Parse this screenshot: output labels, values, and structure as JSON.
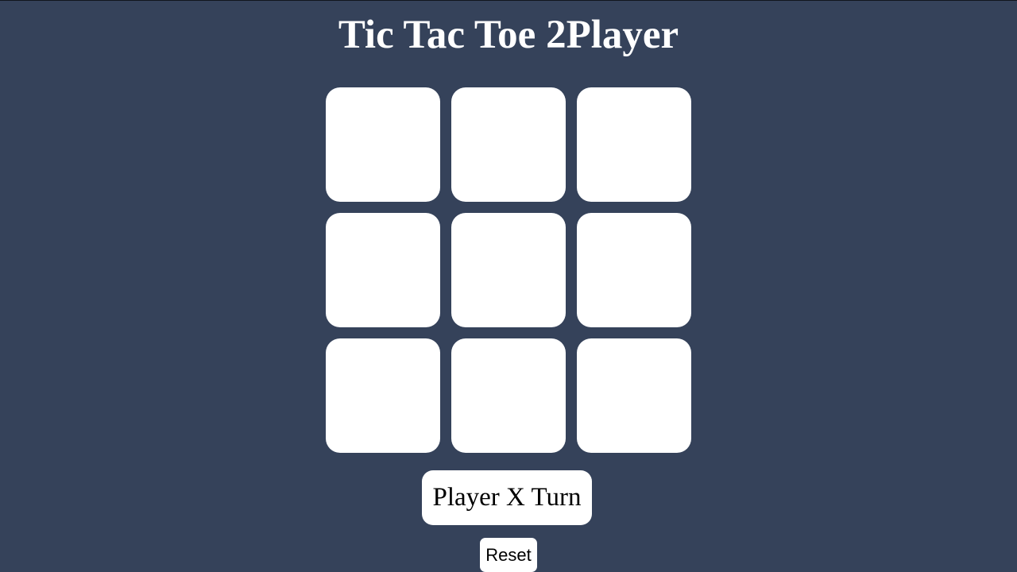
{
  "title": "Tic Tac Toe 2Player",
  "board": {
    "cells": [
      "",
      "",
      "",
      "",
      "",
      "",
      "",
      "",
      ""
    ]
  },
  "status": "Player X Turn",
  "reset_label": "Reset",
  "colors": {
    "background": "#35425a",
    "cell": "#ffffff",
    "text": "#000000"
  }
}
